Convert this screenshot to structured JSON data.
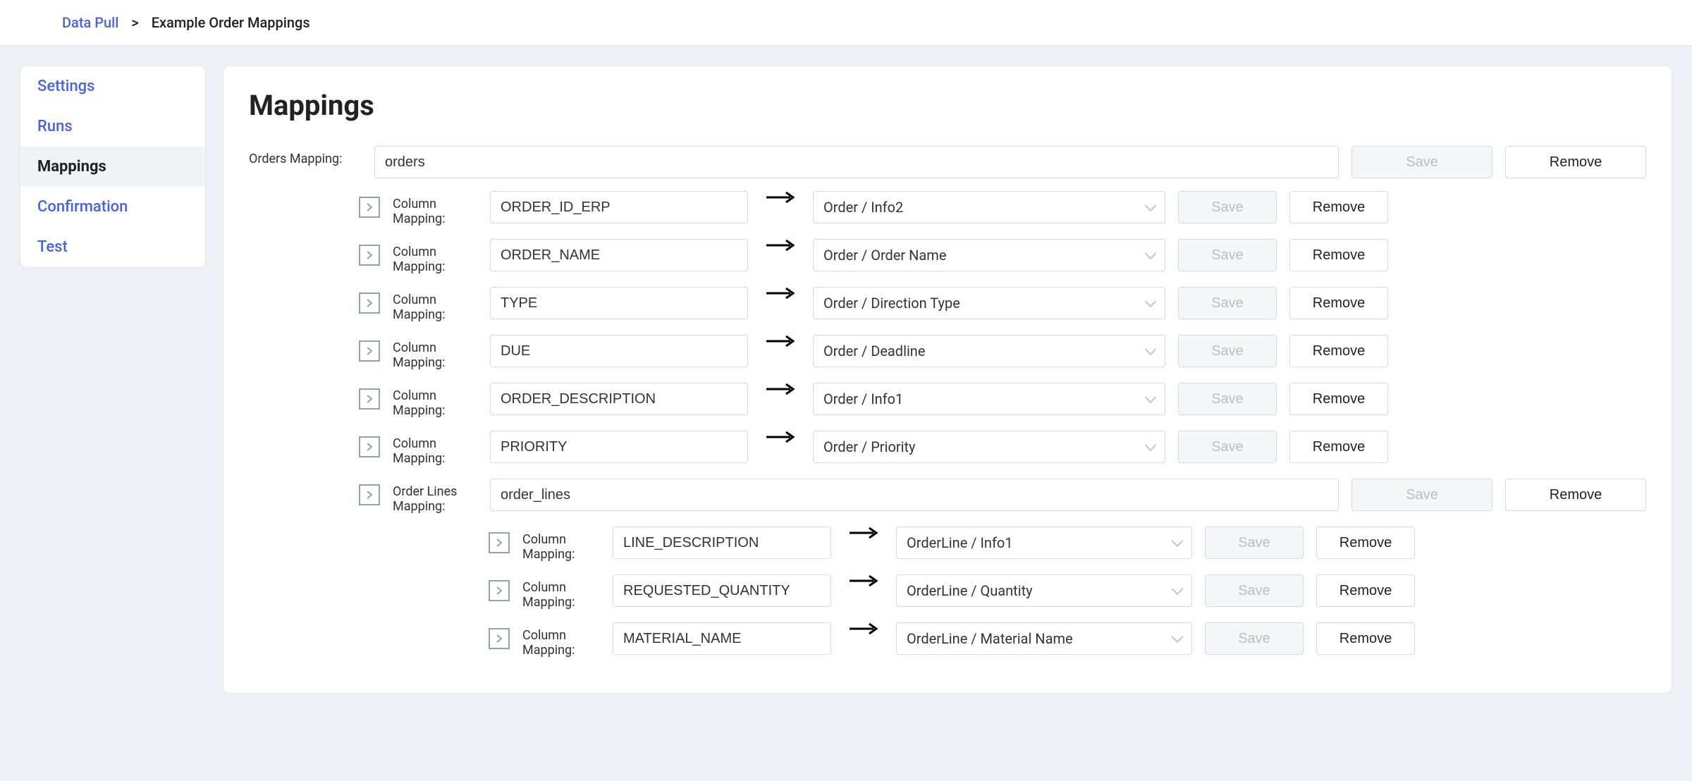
{
  "breadcrumb": {
    "root": "Data Pull",
    "sep": ">",
    "current": "Example Order Mappings"
  },
  "sidebar": {
    "items": [
      {
        "label": "Settings",
        "active": false
      },
      {
        "label": "Runs",
        "active": false
      },
      {
        "label": "Mappings",
        "active": true
      },
      {
        "label": "Confirmation",
        "active": false
      },
      {
        "label": "Test",
        "active": false
      }
    ]
  },
  "page": {
    "title": "Mappings",
    "orders_mapping_label": "Orders Mapping:",
    "column_mapping_label": "Column Mapping:",
    "order_lines_mapping_label": "Order Lines Mapping:",
    "save_label": "Save",
    "remove_label": "Remove"
  },
  "orders_mapping": {
    "value": "orders"
  },
  "order_lines_mapping": {
    "value": "order_lines"
  },
  "column_mappings": [
    {
      "source": "ORDER_ID_ERP",
      "target": "Order / Info2"
    },
    {
      "source": "ORDER_NAME",
      "target": "Order / Order Name"
    },
    {
      "source": "TYPE",
      "target": "Order / Direction Type"
    },
    {
      "source": "DUE",
      "target": "Order / Deadline"
    },
    {
      "source": "ORDER_DESCRIPTION",
      "target": "Order / Info1"
    },
    {
      "source": "PRIORITY",
      "target": "Order / Priority"
    }
  ],
  "line_mappings": [
    {
      "source": "LINE_DESCRIPTION",
      "target": "OrderLine / Info1"
    },
    {
      "source": "REQUESTED_QUANTITY",
      "target": "OrderLine / Quantity"
    },
    {
      "source": "MATERIAL_NAME",
      "target": "OrderLine / Material Name"
    }
  ]
}
